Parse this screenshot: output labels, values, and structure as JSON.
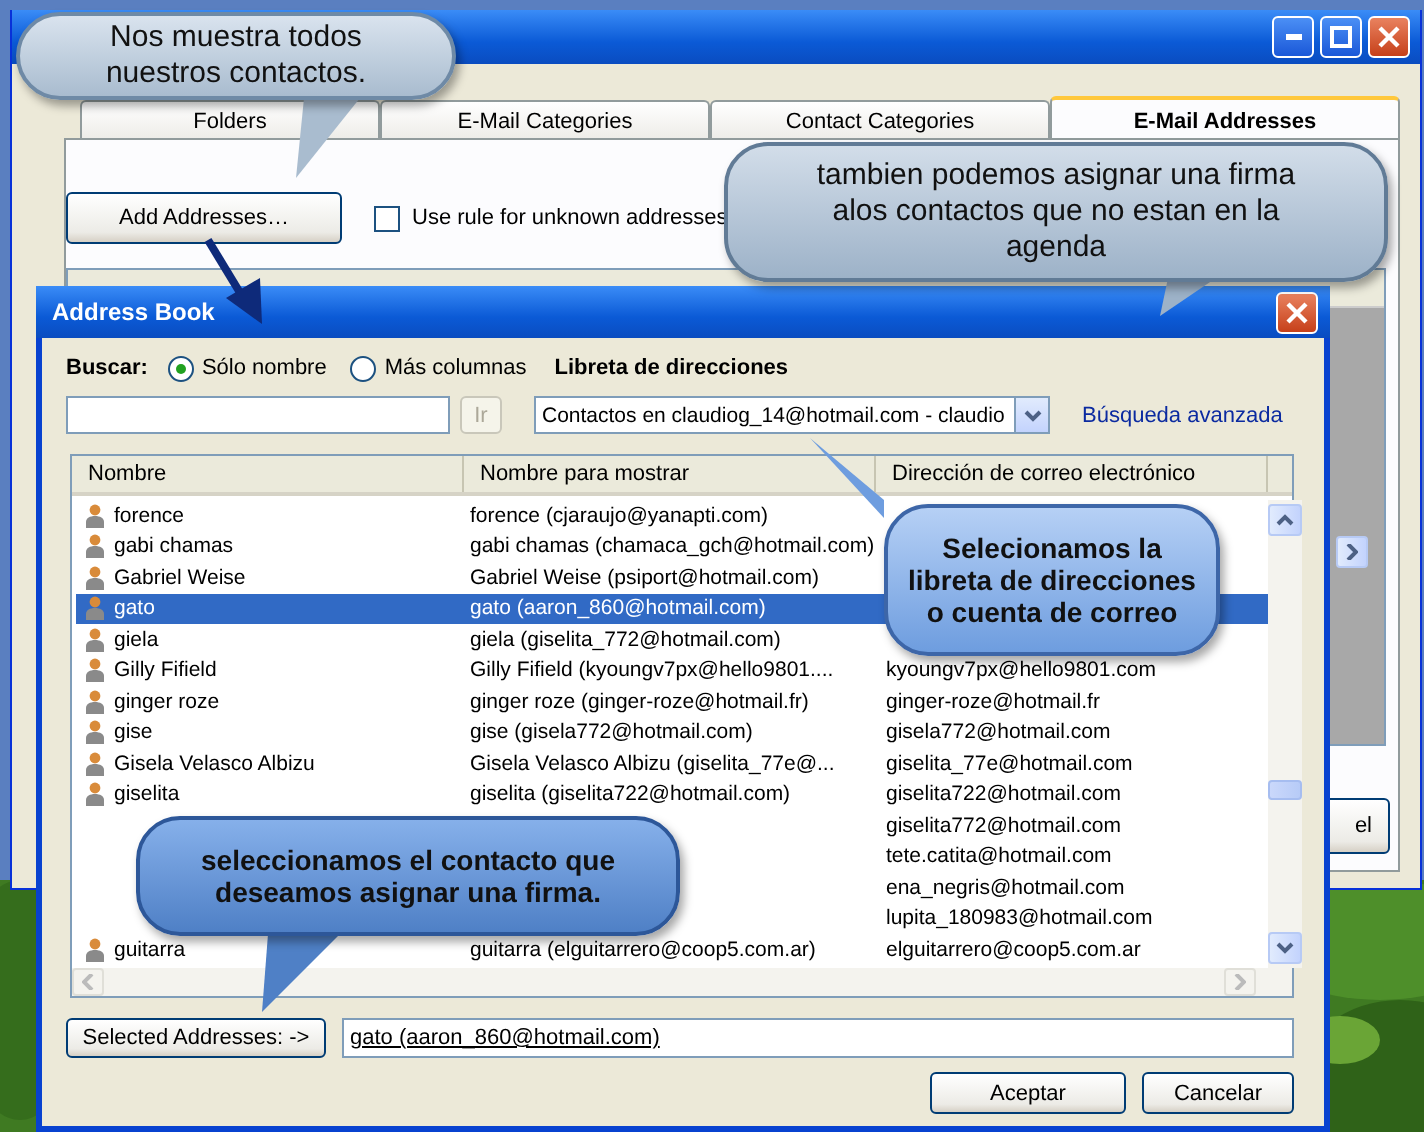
{
  "rules_window": {
    "tabs": [
      {
        "label": "Folders",
        "selected": false
      },
      {
        "label": "E-Mail Categories",
        "selected": false
      },
      {
        "label": "Contact Categories",
        "selected": false
      },
      {
        "label": "E-Mail Addresses",
        "selected": true
      }
    ],
    "add_button": "Add Addresses…",
    "unknown_rule": {
      "label": "Use rule for unknown addresses",
      "checked": false
    },
    "partial_button": "el"
  },
  "address_book": {
    "title": "Address Book",
    "search_label": "Buscar:",
    "search_options": [
      {
        "label": "Sólo nombre",
        "selected": true
      },
      {
        "label": "Más columnas",
        "selected": false
      }
    ],
    "book_label": "Libreta de direcciones",
    "go_button": {
      "label": "Ir",
      "disabled": true
    },
    "book_select": "Contactos en claudiog_14@hotmail.com - claudio",
    "advanced_link": "Búsqueda avanzada",
    "columns": [
      "Nombre",
      "Nombre para mostrar",
      "Dirección de correo electrónico"
    ],
    "rows": [
      {
        "name": "forence",
        "display": "forence  (cjaraujo@yanapti.com)",
        "selected": false
      },
      {
        "name": "gabi chamas",
        "display": "gabi chamas  (chamaca_gch@hotmail.com)",
        "selected": false
      },
      {
        "name": "Gabriel Weise",
        "display": "Gabriel Weise  (psiport@hotmail.com)",
        "selected": false
      },
      {
        "name": "gato",
        "display": "gato  (aaron_860@hotmail.com)",
        "selected": true
      },
      {
        "name": "giela",
        "display": "giela  (giselita_772@hotmail.com)",
        "selected": false
      },
      {
        "name": "Gilly Fifield",
        "display": "Gilly Fifield  (kyoungv7px@hello9801....",
        "email": "kyoungv7px@hello9801.com",
        "selected": false
      },
      {
        "name": "ginger roze",
        "display": "ginger roze  (ginger-roze@hotmail.fr)",
        "email": "ginger-roze@hotmail.fr",
        "selected": false
      },
      {
        "name": "gise",
        "display": "gise  (gisela772@hotmail.com)",
        "email": "gisela772@hotmail.com",
        "selected": false
      },
      {
        "name": "Gisela Velasco Albizu",
        "display": "Gisela Velasco Albizu  (giselita_77e@...",
        "email": "giselita_77e@hotmail.com",
        "selected": false
      },
      {
        "name": "giselita",
        "display": "giselita  (giselita722@hotmail.com)",
        "email": "giselita722@hotmail.com",
        "selected": false
      },
      {
        "email": "giselita772@hotmail.com",
        "selected": false
      },
      {
        "email": "tete.catita@hotmail.com",
        "selected": false
      },
      {
        "email": "ena_negris@hotmail.com",
        "selected": false
      },
      {
        "email": "lupita_180983@hotmail.com",
        "selected": false
      },
      {
        "name": "guitarra",
        "display": "guitarra  (elguitarrero@coop5.com.ar)",
        "email": "elguitarrero@coop5.com.ar",
        "selected": false
      }
    ],
    "selected_button": "Selected Addresses: ->",
    "selected_value": "gato  (aaron_860@hotmail.com)",
    "buttons": [
      "Aceptar",
      "Cancelar"
    ]
  },
  "callouts": [
    {
      "text": "Nos muestra todos nuestros contactos."
    },
    {
      "text": "tambien podemos asignar una firma alos contactos que no estan en la agenda"
    },
    {
      "text": "Selecionamos la libreta de direcciones o cuenta de correo"
    },
    {
      "text": "seleccionamos el contacto que deseamos asignar una firma."
    }
  ]
}
